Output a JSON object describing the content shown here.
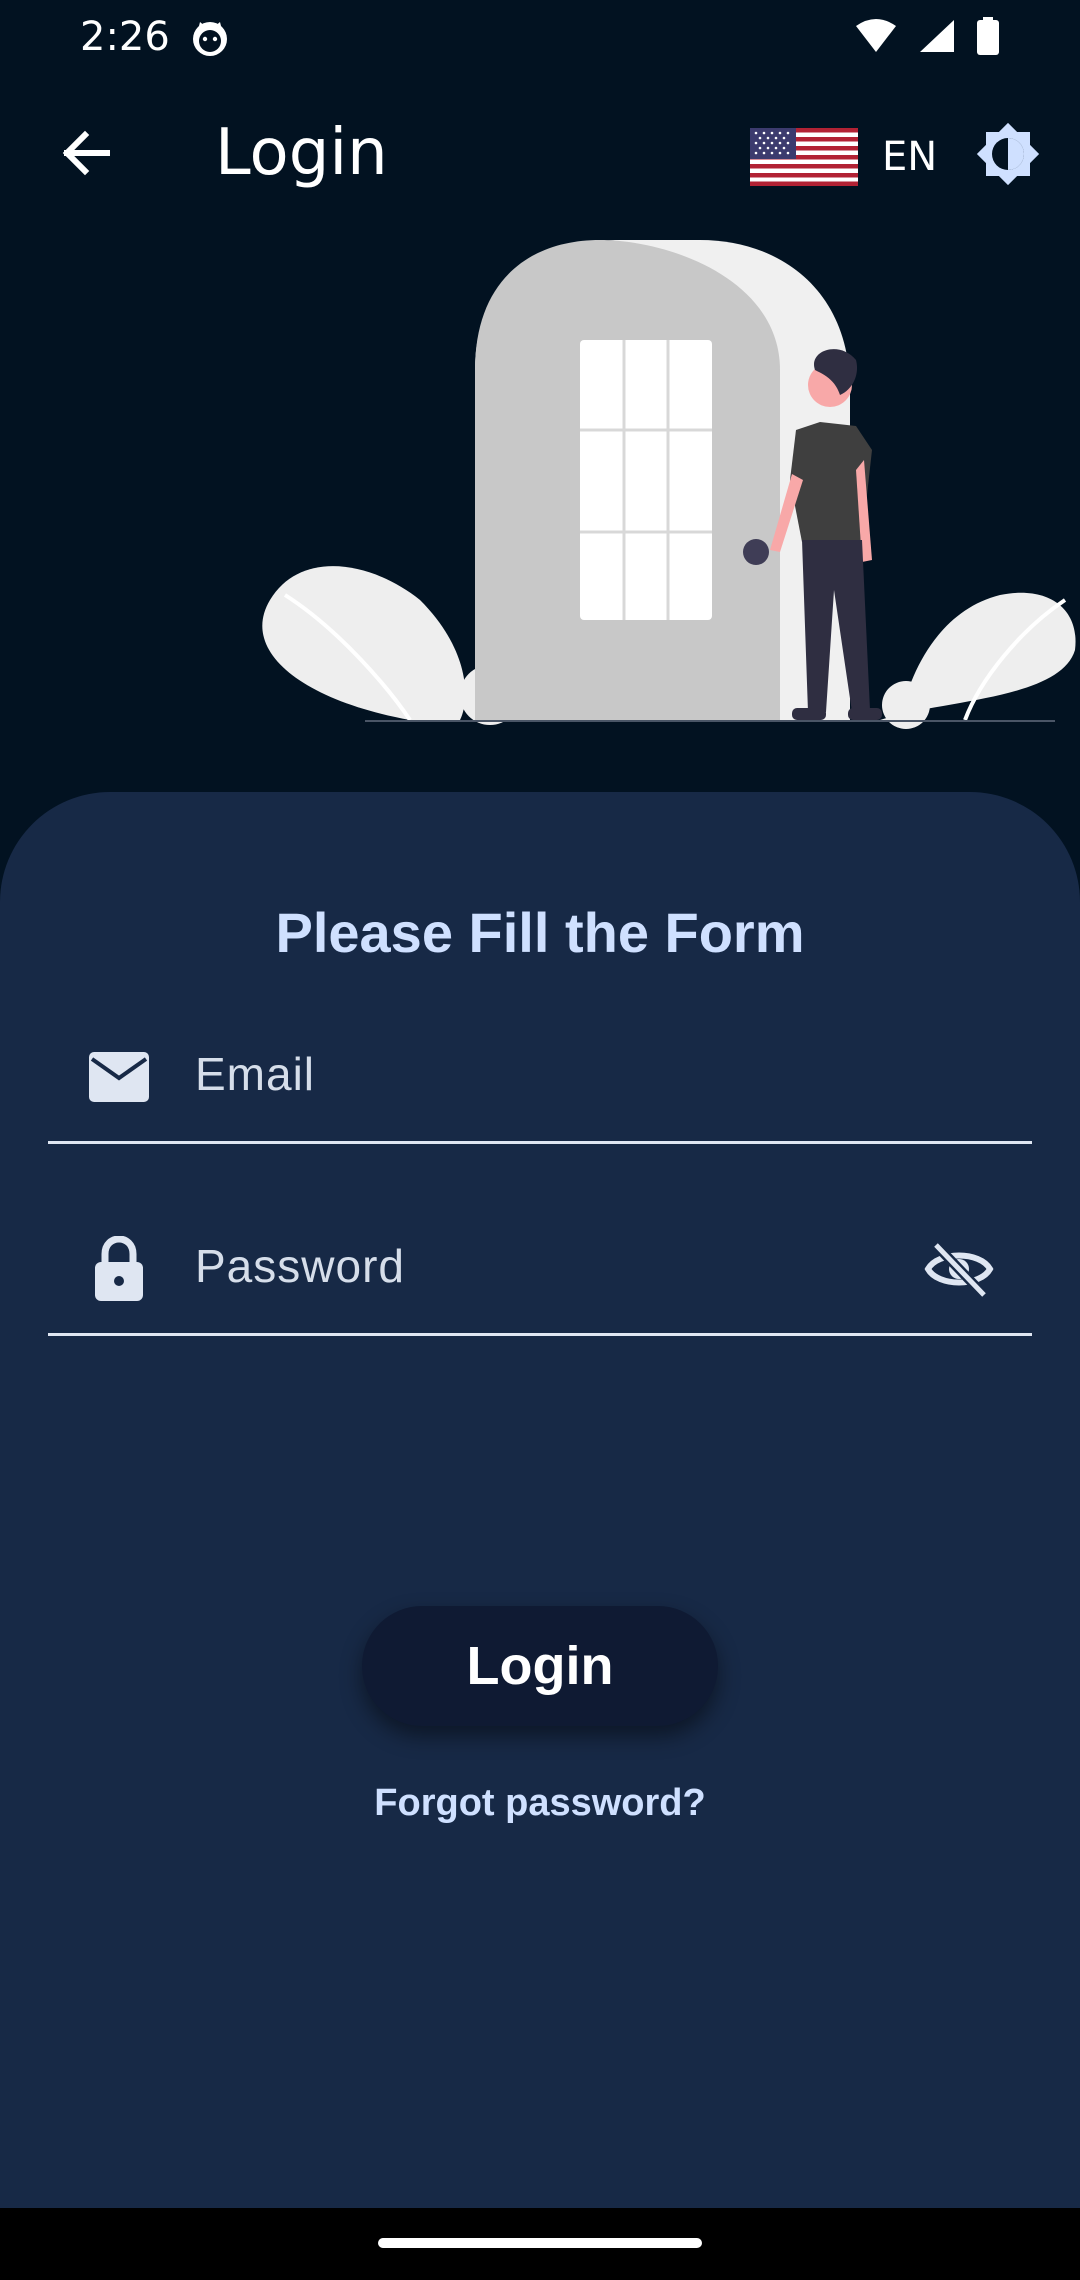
{
  "status_bar": {
    "time": "2:26",
    "icons": [
      "cat-app-icon",
      "wifi-icon",
      "signal-icon",
      "battery-icon"
    ]
  },
  "app_bar": {
    "title": "Login",
    "back_icon": "arrow-back-icon",
    "language": {
      "flag": "us-flag-icon",
      "code": "EN"
    },
    "theme_icon": "brightness-icon"
  },
  "illustration": {
    "name": "person-at-door-illustration"
  },
  "form": {
    "heading": "Please Fill the Form",
    "email": {
      "placeholder": "Email",
      "value": "",
      "icon": "mail-icon"
    },
    "password": {
      "placeholder": "Password",
      "value": "",
      "icon": "lock-icon",
      "visibility_icon": "eye-off-icon"
    },
    "login_label": "Login",
    "forgot_label": "Forgot password?"
  },
  "colors": {
    "background": "#021221",
    "card": "#172946",
    "heading": "#cfe0ff",
    "button": "#0f1a33",
    "text": "#ffffff"
  }
}
